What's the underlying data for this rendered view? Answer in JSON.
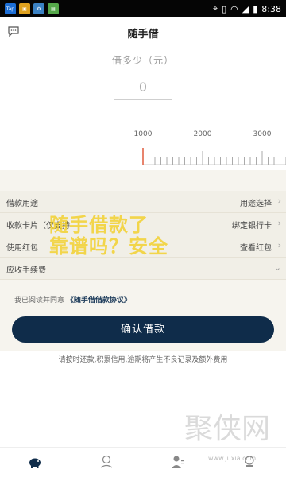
{
  "status_bar": {
    "time": "8:38",
    "apps": [
      {
        "name": "tap-app-icon",
        "label": "Tap",
        "color": "#1d6fd6"
      },
      {
        "name": "shopping-bag-icon",
        "label": "",
        "color": "#e0a21f"
      },
      {
        "name": "settings-app-icon",
        "label": "",
        "color": "#3b82c4"
      },
      {
        "name": "green-app-icon",
        "label": "",
        "color": "#55a84a"
      }
    ]
  },
  "header": {
    "title": "随手借"
  },
  "amount": {
    "label": "借多少（元）",
    "value": "0"
  },
  "ruler": {
    "ticks": [
      "1000",
      "2000",
      "3000"
    ],
    "accent": "#e15b3c"
  },
  "form": {
    "rows": [
      {
        "label": "借款用途",
        "value": "用途选择"
      },
      {
        "label": "收款卡片（仅支持",
        "value": "绑定银行卡"
      },
      {
        "label": "使用红包",
        "value": "查看红包"
      },
      {
        "label": "应收手续费",
        "value": ""
      }
    ]
  },
  "watermark": {
    "line1": "随手借款了",
    "line2": "靠谱吗？安全"
  },
  "agreement": {
    "prefix": "我已阅读并同意",
    "link": "《随手借借款协议》"
  },
  "confirm_button": "确认借款",
  "notice": "请按时还款,积累信用,逾期将产生不良记录及额外费用",
  "site_watermark": {
    "name": "聚侠网",
    "url": "www.juxia.com"
  },
  "colors": {
    "primary": "#0f2c4a",
    "status_bar": "#050505"
  }
}
